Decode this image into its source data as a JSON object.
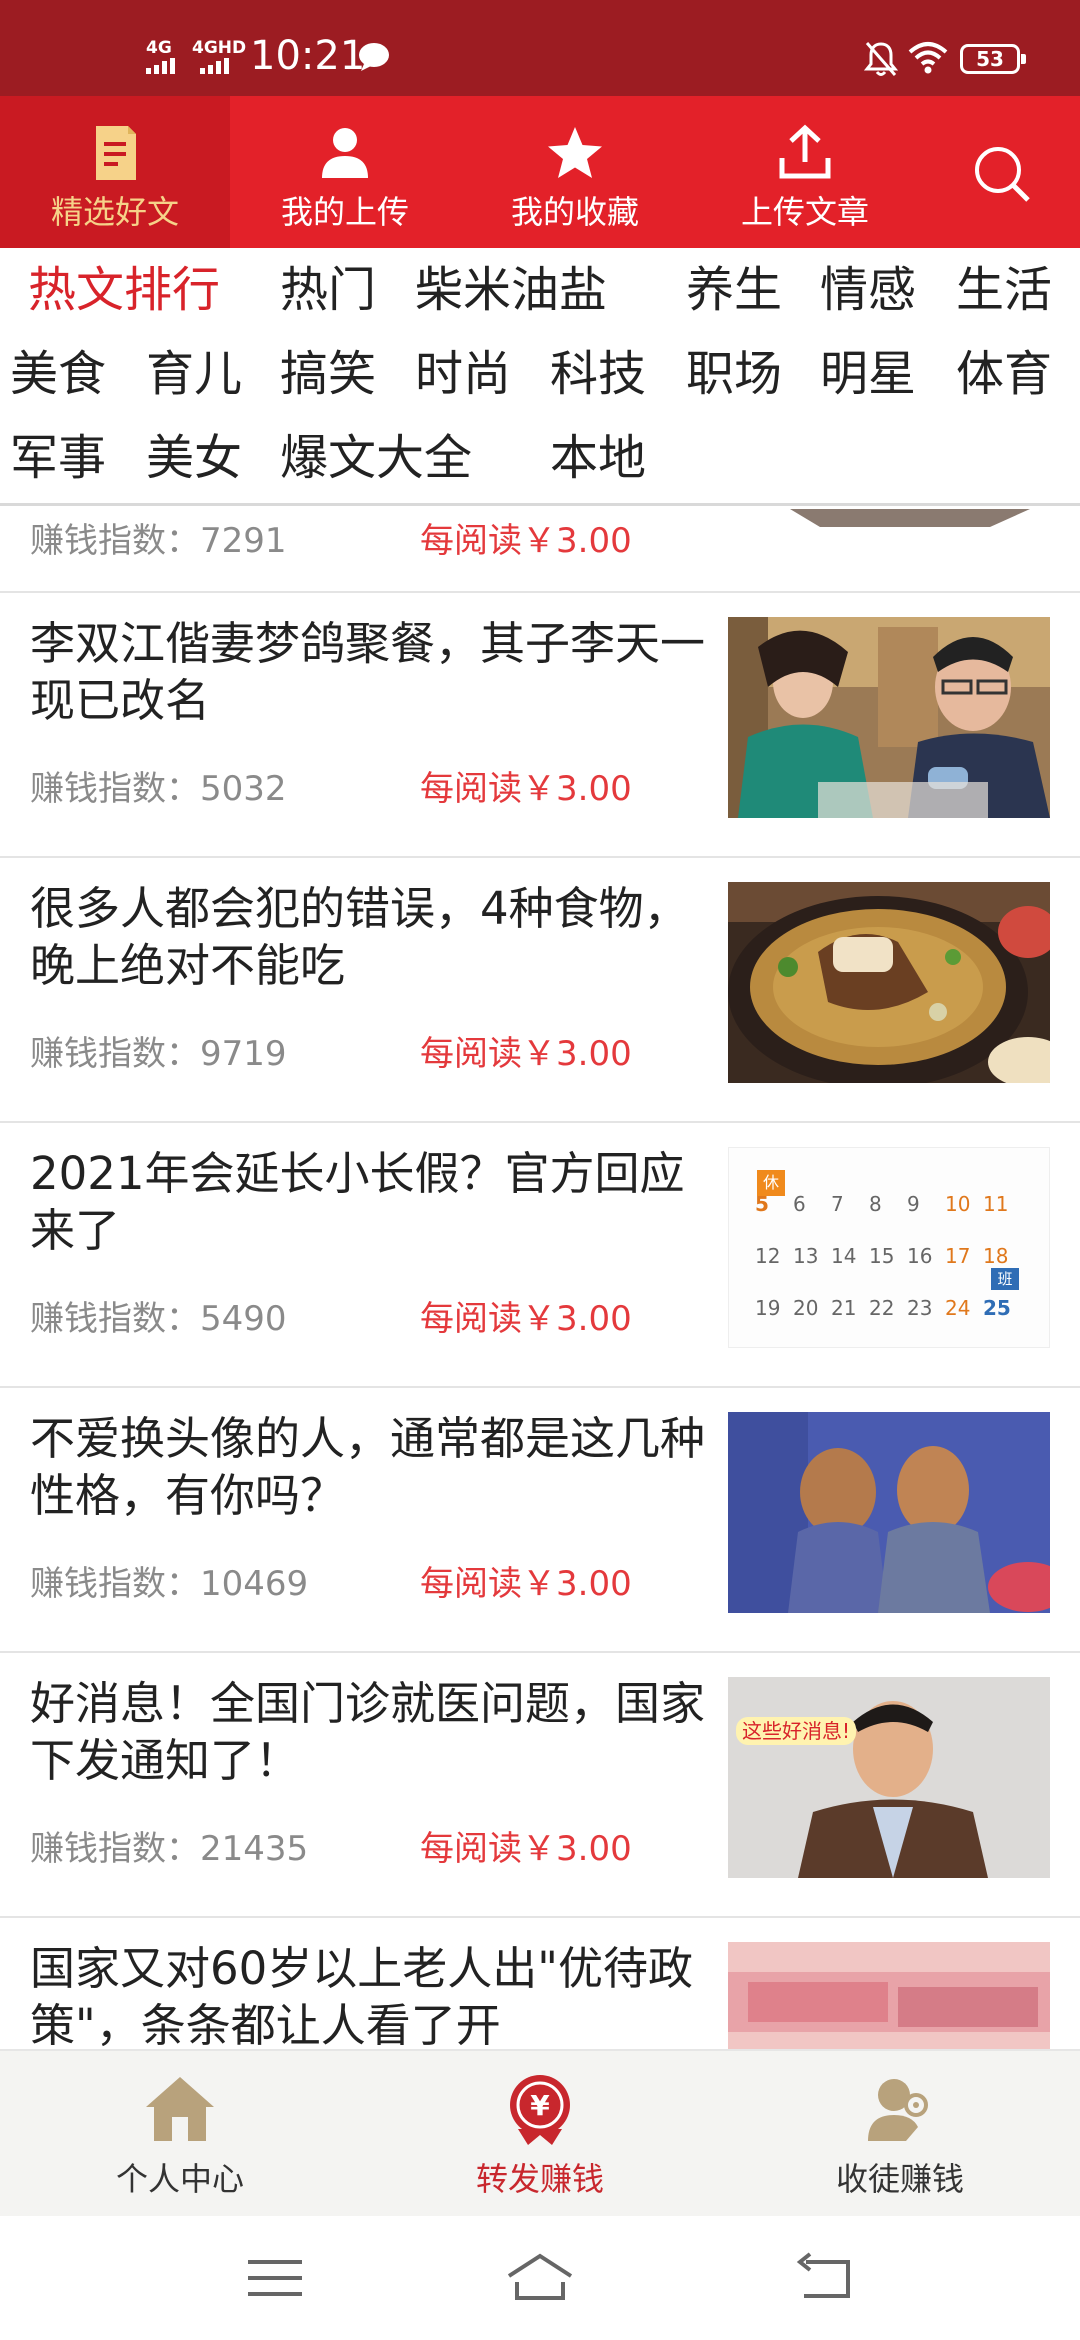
{
  "status_bar": {
    "network_1": "4G",
    "network_2": "4GHD",
    "time": "10:21",
    "battery": "53"
  },
  "top_tabs": [
    {
      "label": "精选好文",
      "icon": "document-icon",
      "active": true
    },
    {
      "label": "我的上传",
      "icon": "person-icon",
      "active": false
    },
    {
      "label": "我的收藏",
      "icon": "star-icon",
      "active": false
    },
    {
      "label": "上传文章",
      "icon": "upload-icon",
      "active": false
    }
  ],
  "search_icon": "search-icon",
  "categories": [
    "热文排行",
    "热门",
    "柴米油盐",
    "养生",
    "情感",
    "生活",
    "美食",
    "育儿",
    "搞笑",
    "时尚",
    "科技",
    "职场",
    "明星",
    "体育",
    "军事",
    "美女",
    "爆文大全",
    "本地"
  ],
  "active_category": "热文排行",
  "partial_top_item": {
    "meta": "赚钱指数：7291",
    "price": "每阅读￥3.00"
  },
  "articles": [
    {
      "title": "李双江偕妻梦鸽聚餐，其子李天一现已改名",
      "meta": "赚钱指数：5032",
      "price": "每阅读￥3.00",
      "thumb": "dinner-photo"
    },
    {
      "title": "很多人都会犯的错误，4种食物，晚上绝对不能吃",
      "meta": "赚钱指数：9719",
      "price": "每阅读￥3.00",
      "thumb": "soup-photo"
    },
    {
      "title": "2021年会延长小长假？官方回应来了",
      "meta": "赚钱指数：5490",
      "price": "每阅读￥3.00",
      "thumb": "calendar-image"
    },
    {
      "title": "不爱换头像的人，通常都是这几种性格，有你吗？",
      "meta": "赚钱指数：10469",
      "price": "每阅读￥3.00",
      "thumb": "couple-photo"
    },
    {
      "title": "好消息！全国门诊就医问题，国家下发通知了！",
      "meta": "赚钱指数：21435",
      "price": "每阅读￥3.00",
      "thumb": "news-photo"
    },
    {
      "title": "国家又对60岁以上老人出\"优待政策\"，条条都让人看了开",
      "meta": "",
      "price": "",
      "thumb": "money-photo"
    }
  ],
  "calendar": {
    "rest_badge": "休",
    "work_badge": "班",
    "row1": [
      "5",
      "6",
      "7",
      "8",
      "9",
      "10",
      "11"
    ],
    "row2": [
      "12",
      "13",
      "14",
      "15",
      "16",
      "17",
      "18"
    ],
    "row3": [
      "19",
      "20",
      "21",
      "22",
      "23",
      "24",
      "25"
    ]
  },
  "news_caption": "这些好消息!",
  "bottom_tabs": [
    {
      "label": "个人中心",
      "icon": "home-icon",
      "active": false
    },
    {
      "label": "转发赚钱",
      "icon": "yuan-coin-icon",
      "active": true
    },
    {
      "label": "收徒赚钱",
      "icon": "user-add-icon",
      "active": false
    }
  ],
  "colors": {
    "status_bar": "#9c1c22",
    "header_red": "#e32129",
    "active_tab_text": "#f6d289",
    "accent_red": "#d8232a",
    "price_red": "#e4393c",
    "bottom_icon_gold": "#b8a27c"
  }
}
